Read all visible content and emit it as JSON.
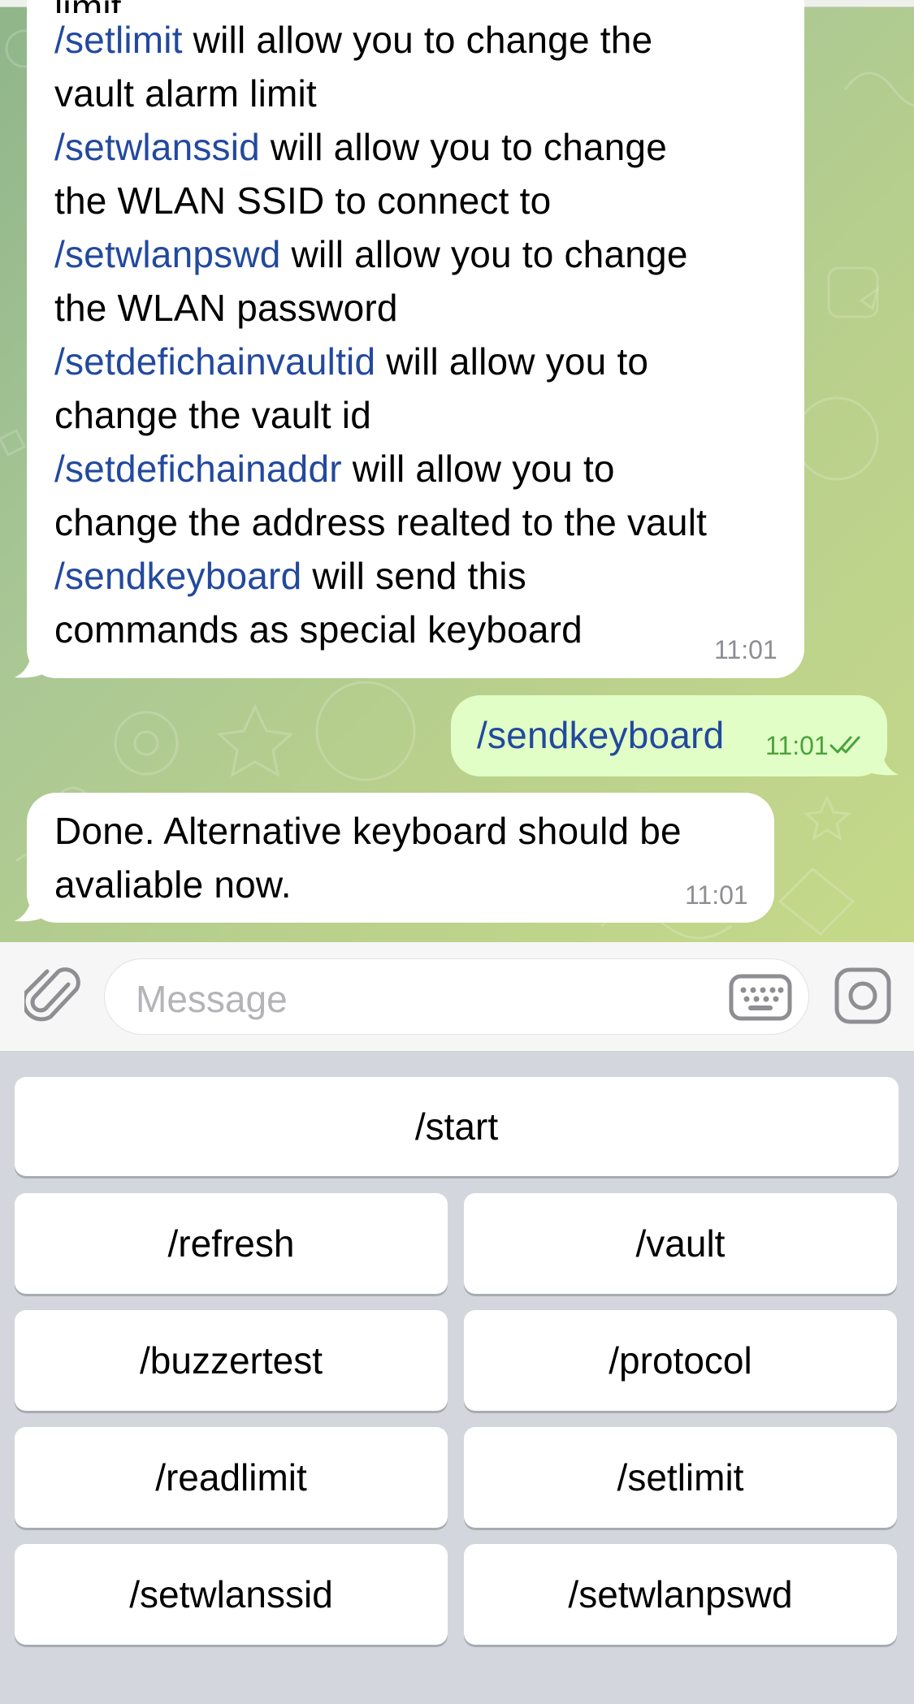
{
  "chat": {
    "partial_top_text": "limit",
    "help_message": {
      "lines": [
        {
          "cmd": "/setlimit",
          "text": " will allow you to change the"
        },
        {
          "cmd": "",
          "text": "vault alarm limit"
        },
        {
          "cmd": "/setwlanssid",
          "text": " will allow you to change"
        },
        {
          "cmd": "",
          "text": "the WLAN SSID to connect to"
        },
        {
          "cmd": "/setwlanpswd",
          "text": " will allow you to change"
        },
        {
          "cmd": "",
          "text": "the WLAN password"
        },
        {
          "cmd": "/setdefichainvaultid",
          "text": " will allow you to"
        },
        {
          "cmd": "",
          "text": "change the vault id"
        },
        {
          "cmd": "/setdefichainaddr",
          "text": " will allow you to"
        },
        {
          "cmd": "",
          "text": "change the address realted to the vault"
        },
        {
          "cmd": "/sendkeyboard",
          "text": " will send this"
        },
        {
          "cmd": "",
          "text": "commands as special keyboard"
        }
      ],
      "time": "11:01"
    },
    "outgoing": {
      "text": "/sendkeyboard",
      "time": "11:01",
      "status": "read-double-check"
    },
    "reply": {
      "line1": "Done. Alternative keyboard should be",
      "line2": "avaliable now.",
      "time": "11:01"
    }
  },
  "input": {
    "placeholder": "Message",
    "attach_icon": "paperclip-icon",
    "keyboard_icon": "keyboard-icon",
    "sticker_icon": "sticker-icon"
  },
  "keyboard": {
    "rows": [
      [
        "/start"
      ],
      [
        "/refresh",
        "/vault"
      ],
      [
        "/buzzertest",
        "/protocol"
      ],
      [
        "/readlimit",
        "/setlimit"
      ],
      [
        "/setwlanssid",
        "/setwlanpswd"
      ]
    ]
  },
  "colors": {
    "command_link": "#22499e",
    "outgoing_bubble": "#e1fec6",
    "read_check": "#4aa23c"
  }
}
